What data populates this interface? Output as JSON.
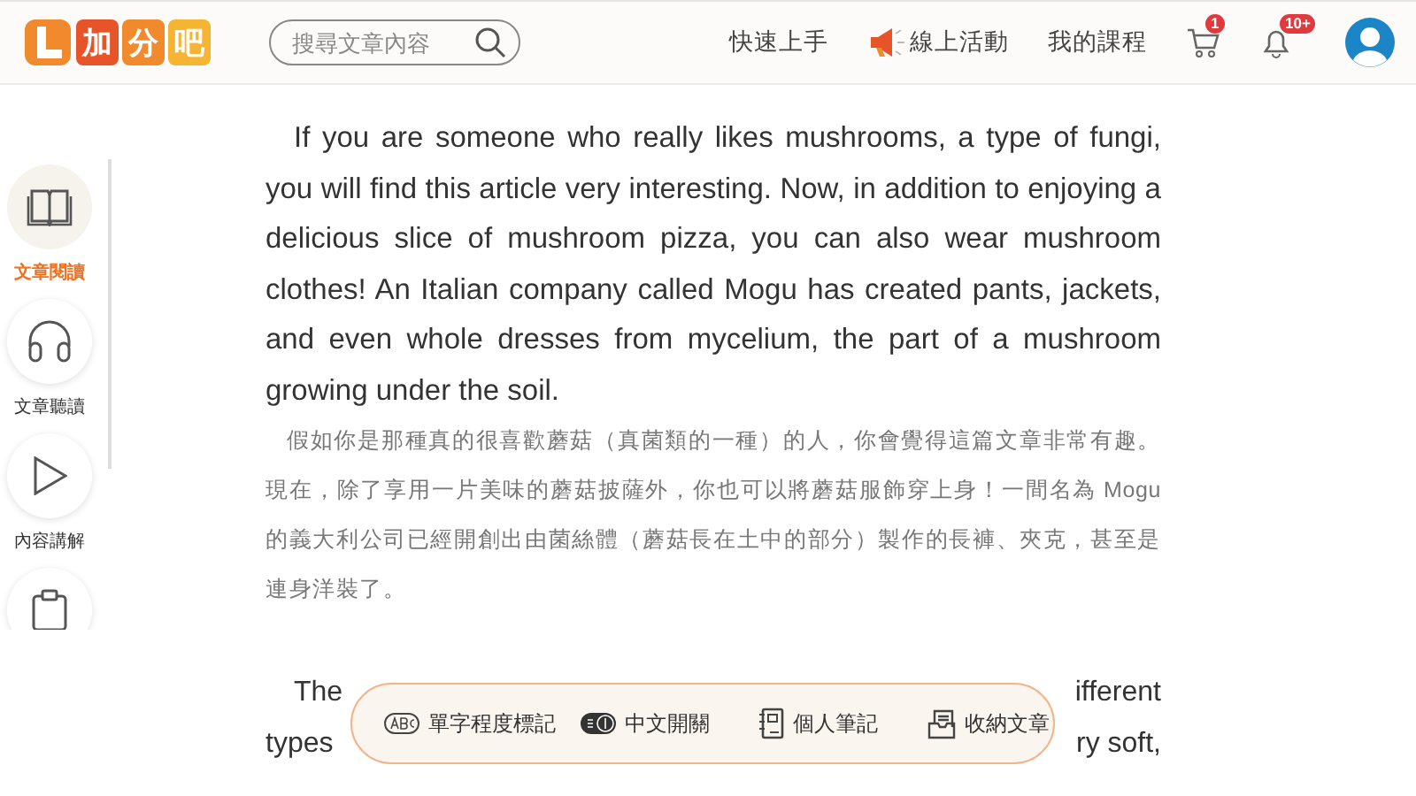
{
  "header": {
    "logo": [
      "加",
      "分",
      "吧"
    ],
    "search": {
      "placeholder": "搜尋文章內容"
    },
    "nav": [
      {
        "label": "快速上手",
        "kind": "text"
      },
      {
        "label": "線上活動",
        "kind": "megaphone"
      },
      {
        "label": "我的課程",
        "kind": "text"
      }
    ],
    "cart_badge": "1",
    "bell_badge": "10+"
  },
  "sidebar": {
    "items": [
      {
        "label": "文章閱讀",
        "kind": "book",
        "selected": true
      },
      {
        "label": "文章聽讀",
        "kind": "headphones",
        "selected": false
      },
      {
        "label": "內容講解",
        "kind": "play",
        "selected": false
      },
      {
        "kind": "clipboard",
        "selected": false
      }
    ]
  },
  "article": {
    "english": "If you are someone who really likes mushrooms, a type of fungi, you will find this article very interesting. Now, in addition to enjoying a delicious slice of mushroom pizza, you can also wear mushroom clothes! An Italian company called Mogu has created pants, jackets, and even whole dresses from mycelium, the part of a mushroom growing under the soil.",
    "chinese": "假如你是那種真的很喜歡蘑菇（真菌類的一種）的人，你會覺得這篇文章非常有趣。現在，除了享用一片美味的蘑菇披薩外，你也可以將蘑菇服飾穿上身！一間名為 Mogu 的義大利公司已經開創出由菌絲體（蘑菇長在土中的部分）製作的長褲、夾克，甚至是連身洋裝了。",
    "partial_lines": [
      {
        "left": "The",
        "right": "ifferent"
      },
      {
        "left": "types",
        "right": "ry soft,"
      }
    ]
  },
  "toolbar": [
    {
      "label": "單字程度標記",
      "kind": "abc"
    },
    {
      "label": "中文開關",
      "kind": "toggle"
    },
    {
      "label": "個人筆記",
      "kind": "notebook"
    },
    {
      "label": "收納文章",
      "kind": "archive"
    }
  ]
}
